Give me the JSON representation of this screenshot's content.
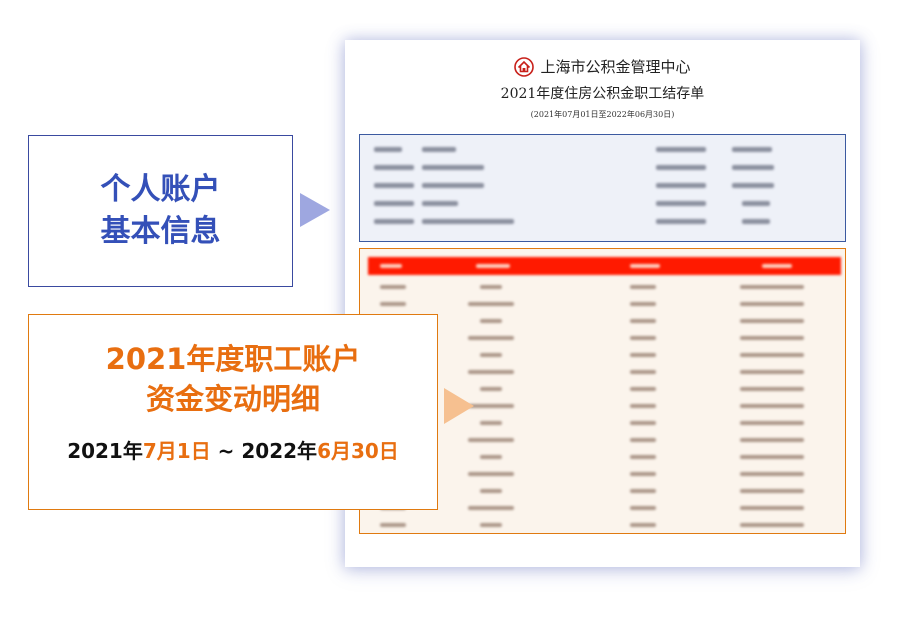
{
  "document": {
    "organization": "上海市公积金管理中心",
    "title": "2021年度住房公积金职工结存单",
    "period": "(2021年07月01日至2022年06月30日)"
  },
  "callouts": {
    "basic_info": {
      "line1": "个人账户",
      "line2": "基本信息"
    },
    "details": {
      "line1": "2021年度职工账户",
      "line2": "资金变动明细",
      "date_start_year": "2021年",
      "date_start_md": "7月1日",
      "separator": " ~ ",
      "date_end_year": "2022年",
      "date_end_md": "6月30日"
    }
  },
  "colors": {
    "blue_accent": "#3450b8",
    "orange_accent": "#e86e10",
    "table_header_red": "#ff1a00"
  }
}
